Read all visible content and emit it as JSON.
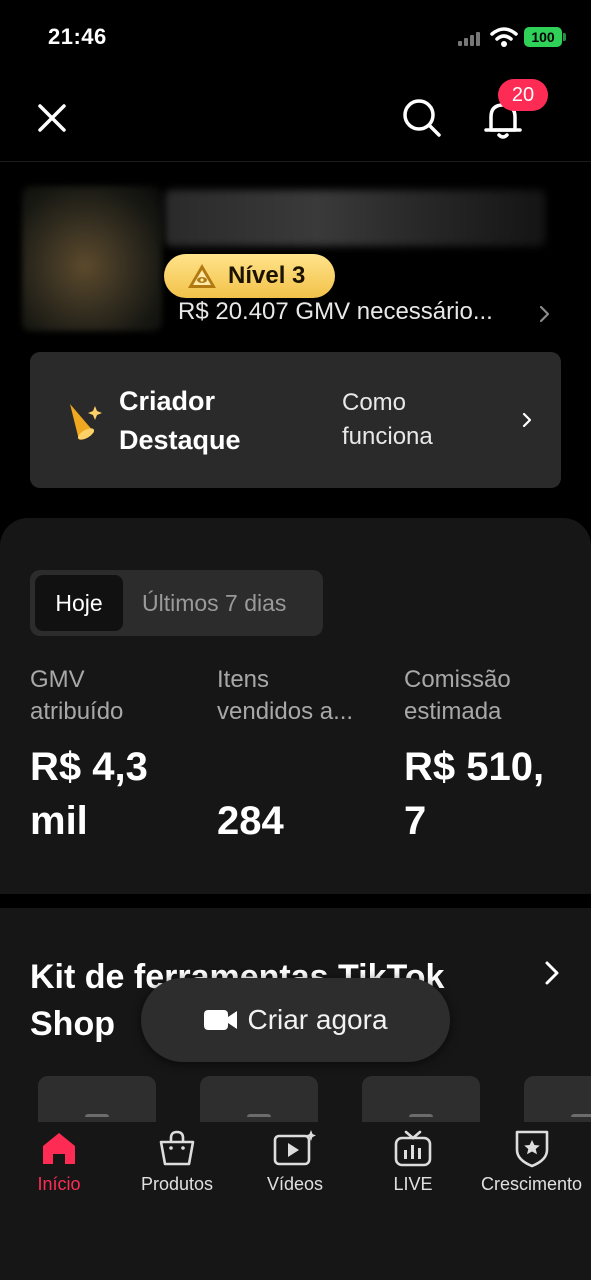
{
  "status_bar": {
    "time": "21:46",
    "battery": "100"
  },
  "header": {
    "notification_count": "20"
  },
  "profile": {
    "level": "Nível 3",
    "gmv_needed": "R$ 20.407 GMV necessário..."
  },
  "featured_card": {
    "title": "Criador Destaque",
    "how_it_works": "Como funciona"
  },
  "period_tabs": {
    "today": "Hoje",
    "last7": "Últimos 7 dias"
  },
  "metrics": [
    {
      "label_line1": "GMV",
      "label_line2": "atribuído",
      "value_line1": "R$ 4,3",
      "value_line2": "mil"
    },
    {
      "label_line1": "Itens",
      "label_line2": "vendidos a...",
      "value_line1": "",
      "value_line2": "284"
    },
    {
      "label_line1": "Comissão",
      "label_line2": "estimada",
      "value_line1": "R$ 510,",
      "value_line2": "7"
    }
  ],
  "toolkit": {
    "title_line1": "Kit de ferramentas TikTok",
    "title_line2": "Shop"
  },
  "create_button": {
    "label": "Criar agora"
  },
  "bottom_nav": [
    {
      "label": "Início",
      "icon": "home-icon",
      "active": true
    },
    {
      "label": "Produtos",
      "icon": "shopping-bag-icon",
      "active": false
    },
    {
      "label": "Vídeos",
      "icon": "video-sparkle-icon",
      "active": false
    },
    {
      "label": "LIVE",
      "icon": "live-tv-icon",
      "active": false
    },
    {
      "label": "Crescimento",
      "icon": "badge-star-icon",
      "active": false
    }
  ],
  "colors": {
    "accent": "#fe2c55",
    "level_gold": "#f2c24a",
    "battery_green": "#30d158"
  }
}
